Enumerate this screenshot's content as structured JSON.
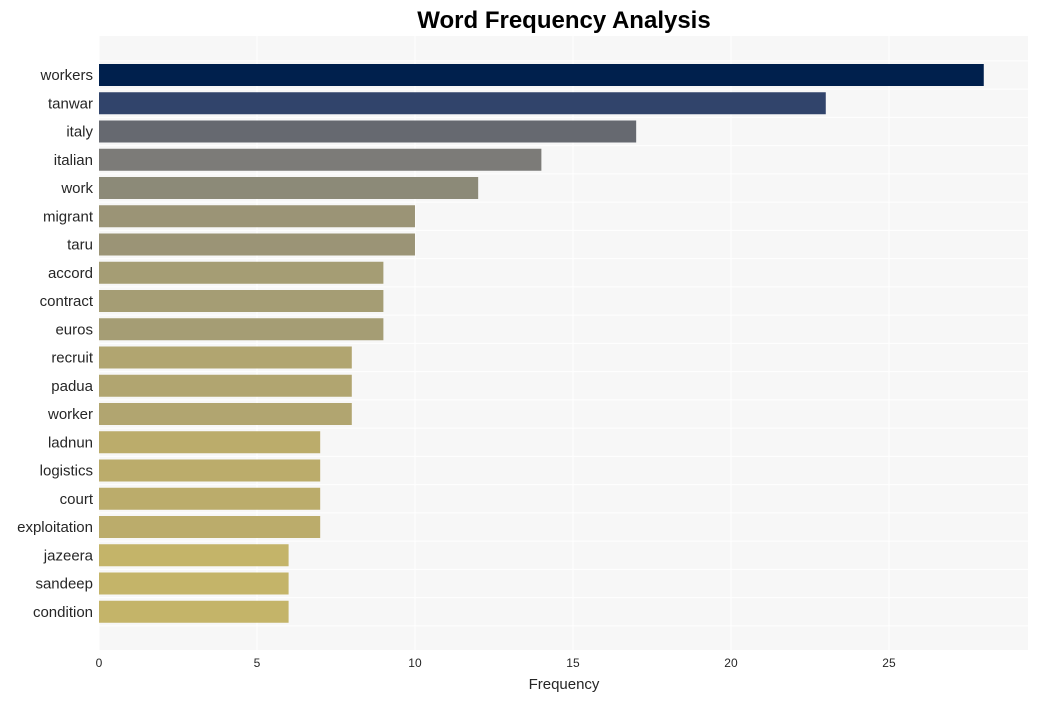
{
  "chart_data": {
    "type": "bar",
    "orientation": "horizontal",
    "title": "Word Frequency Analysis",
    "xlabel": "Frequency",
    "ylabel": "",
    "xlim": [
      0,
      29.4
    ],
    "xticks": [
      0,
      5,
      10,
      15,
      20,
      25
    ],
    "grid": true,
    "legend": "none",
    "categories": [
      "workers",
      "tanwar",
      "italy",
      "italian",
      "work",
      "migrant",
      "taru",
      "accord",
      "contract",
      "euros",
      "recruit",
      "padua",
      "worker",
      "ladnun",
      "logistics",
      "court",
      "exploitation",
      "jazeera",
      "sandeep",
      "condition"
    ],
    "values": [
      28,
      23,
      17,
      14,
      12,
      10,
      10,
      9,
      9,
      9,
      8,
      8,
      8,
      7,
      7,
      7,
      7,
      6,
      6,
      6
    ],
    "colors": [
      "#00204d",
      "#31446b",
      "#666970",
      "#7c7b78",
      "#8c8a78",
      "#9b9476",
      "#9b9476",
      "#a59d74",
      "#a59d74",
      "#a59d74",
      "#b1a570",
      "#b1a570",
      "#b1a570",
      "#bbac6b",
      "#bbac6b",
      "#bbac6b",
      "#bbac6b",
      "#c4b469",
      "#c4b469",
      "#c4b469"
    ],
    "plot_background": "#f7f7f7"
  }
}
